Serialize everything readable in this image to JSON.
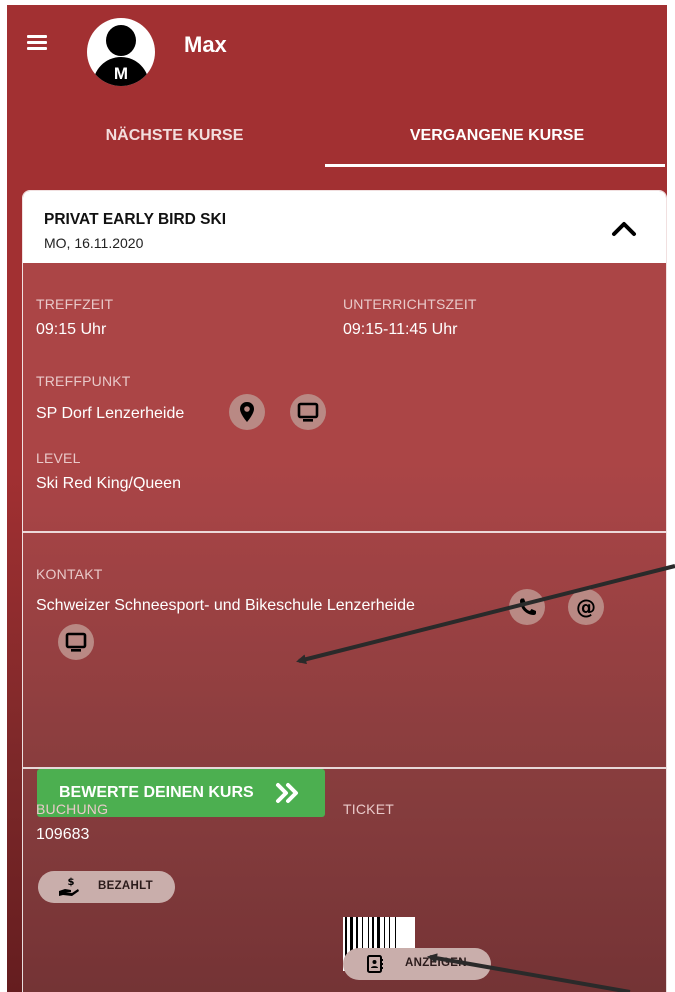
{
  "header": {
    "user_name": "Max",
    "avatar_initial": "M",
    "icons": [
      "menu-icon",
      "user-avatar-icon"
    ]
  },
  "tabs": [
    {
      "label": "NÄCHSTE KURSE",
      "active": false
    },
    {
      "label": "VERGANGENE KURSE",
      "active": true
    }
  ],
  "course": {
    "title": "PRIVAT EARLY BIRD SKI",
    "date": "MO, 16.11.2020",
    "collapse_icon": "chevron-up-icon",
    "meeting_time": {
      "label": "TREFFZEIT",
      "value": "09:15 Uhr"
    },
    "lesson_time": {
      "label": "UNTERRICHTSZEIT",
      "value": "09:15-11:45 Uhr"
    },
    "meeting_point": {
      "label": "TREFFPUNKT",
      "value": "SP Dorf Lenzerheide",
      "icons": [
        "map-marker-icon",
        "monitor-icon"
      ]
    },
    "level": {
      "label": "LEVEL",
      "value": "Ski Red King/Queen"
    },
    "contact": {
      "label": "KONTAKT",
      "value": "Schweizer Schneesport- und Bikeschule Lenzerheide",
      "icons": [
        "phone-icon",
        "at-icon",
        "monitor-icon"
      ]
    },
    "rate_button": {
      "label": "BEWERTE DEINEN KURS",
      "icon": "double-chevron-right-icon"
    },
    "booking": {
      "label": "BUCHUNG",
      "value": "109683",
      "paid_label": "BEZAHLT",
      "paid_icon": "hand-dollar-icon"
    },
    "ticket": {
      "label": "TICKET",
      "show_label": "ANZEIGEN",
      "show_icon": "contact-card-icon",
      "barcode_icon": "barcode-icon"
    }
  },
  "colors": {
    "primary": "#a23032",
    "primary_dark": "#651d1f",
    "accent_green": "#4caf50",
    "label_text": "#e9c9c9",
    "pill_bg": "#c9aeab"
  }
}
